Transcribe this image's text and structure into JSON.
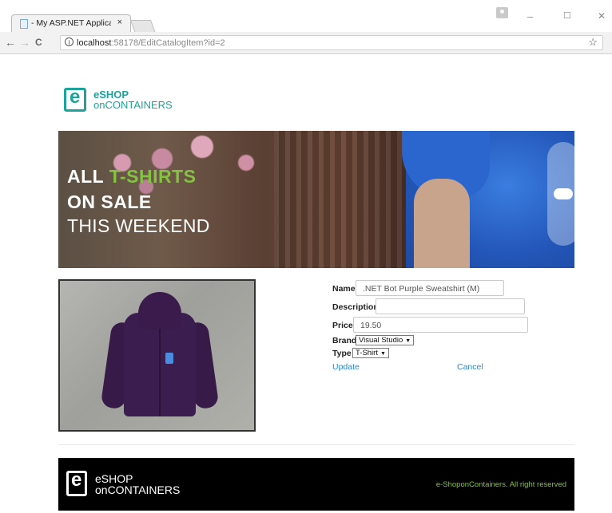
{
  "browser": {
    "tab_title": "- My ASP.NET Applicatio",
    "tab_close": "×",
    "url_host": "localhost",
    "url_rest": ":58178/EditCatalogItem?id=2",
    "win_minimize": "–",
    "win_maximize": "☐",
    "win_close": "✕",
    "back": "←",
    "forward": "→",
    "reload": "C",
    "bookmark_star": "☆",
    "info_icon": "i"
  },
  "logo": {
    "mark": "e",
    "line1": "eSHOP",
    "line2": "onCONTAINERS",
    "color": "#1ba39c"
  },
  "hero": {
    "line1_a": "ALL ",
    "line1_b": "T-SHIRTS",
    "line2": "ON SALE",
    "line3": "THIS WEEKEND",
    "highlight_color": "#83c341"
  },
  "form": {
    "name_label": "Name",
    "name_value": ".NET Bot Purple Sweatshirt (M)",
    "description_label": "Description",
    "description_value": "",
    "price_label": "Price",
    "price_value": "19.50",
    "brand_label": "Brand",
    "brand_value": "Visual Studio",
    "type_label": "Type",
    "type_value": "T-Shirt",
    "caret": "▼",
    "update_label": "Update",
    "cancel_label": "Cancel",
    "link_color": "#2f86c8"
  },
  "footer": {
    "mark": "e",
    "line1": "eSHOP",
    "line2": "onCONTAINERS",
    "copyright": "e-ShoponContainers. All right reserved",
    "copyright_color": "#83c341"
  }
}
